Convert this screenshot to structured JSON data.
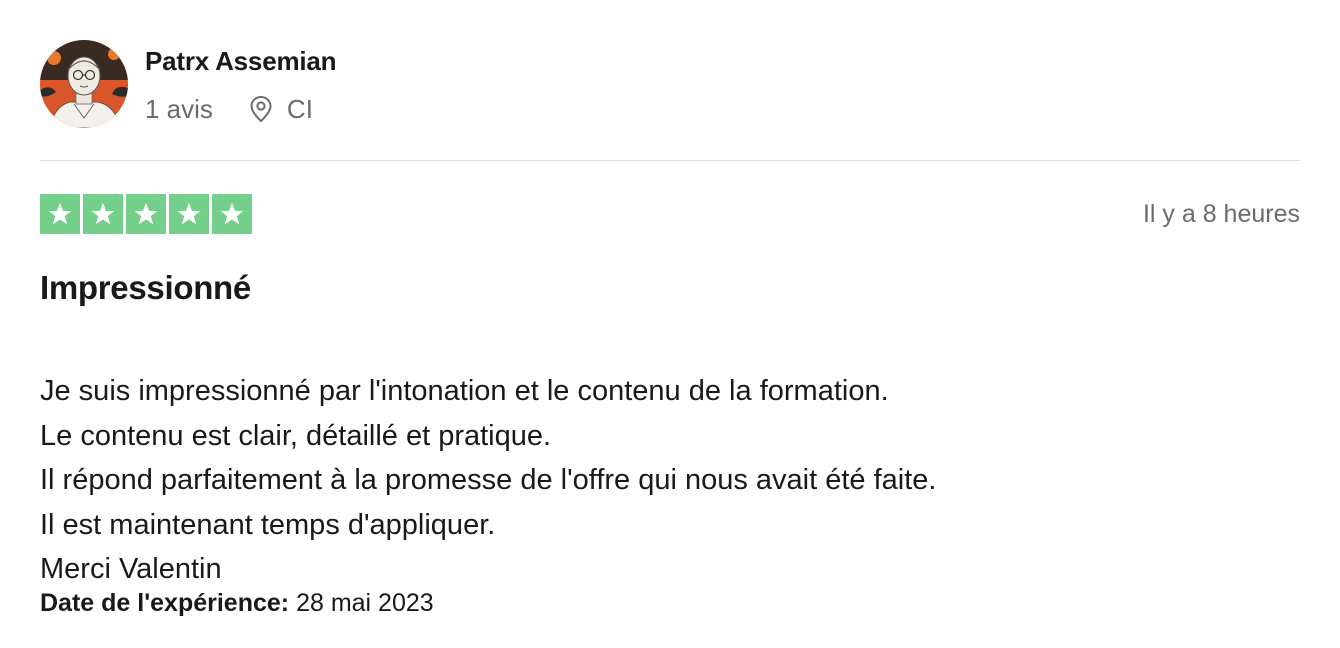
{
  "reviewer": {
    "name": "Patrx Assemian",
    "review_count": "1 avis",
    "location": "CI",
    "avatar_icon": "user-avatar-portrait",
    "location_icon": "map-pin-icon"
  },
  "review": {
    "rating": 5,
    "rating_max": 5,
    "star_color": "#73cf8a",
    "time_ago": "Il y a 8 heures",
    "title": "Impressionné",
    "body_lines": [
      "Je suis impressionné par l'intonation et le contenu de la formation.",
      "Le contenu est clair, détaillé et pratique.",
      "Il répond parfaitement à la promesse de l'offre qui nous avait été faite.",
      "Il est maintenant temps d'appliquer.",
      "Merci Valentin"
    ],
    "experience_label": "Date de l'expérience:",
    "experience_date": "28 mai 2023"
  }
}
